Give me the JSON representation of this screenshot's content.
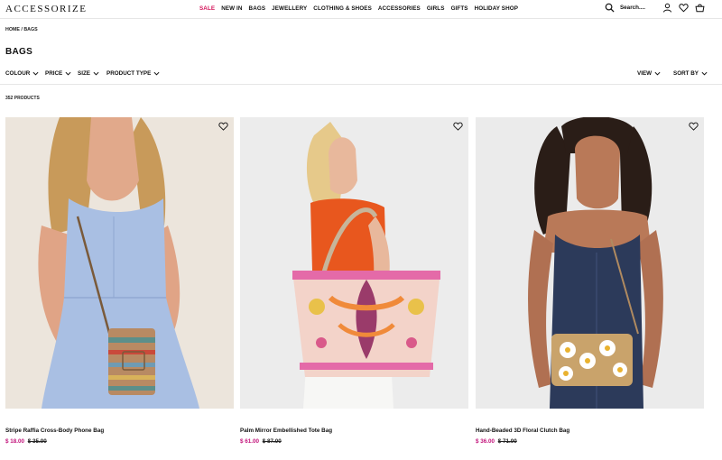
{
  "header": {
    "logo": "ACCESSORIZE",
    "nav": [
      {
        "label": "SALE",
        "name": "nav-item-sale"
      },
      {
        "label": "NEW IN",
        "name": "nav-item-new-in"
      },
      {
        "label": "BAGS",
        "name": "nav-item-bags"
      },
      {
        "label": "JEWELLERY",
        "name": "nav-item-jewellery"
      },
      {
        "label": "CLOTHING & SHOES",
        "name": "nav-item-clothing-shoes"
      },
      {
        "label": "ACCESSORIES",
        "name": "nav-item-accessories"
      },
      {
        "label": "GIRLS",
        "name": "nav-item-girls"
      },
      {
        "label": "GIFTS",
        "name": "nav-item-gifts"
      },
      {
        "label": "HOLIDAY SHOP",
        "name": "nav-item-holiday-shop"
      }
    ],
    "search_placeholder": "Search....",
    "icons": [
      "search-icon",
      "account-icon",
      "wishlist-icon",
      "basket-icon"
    ]
  },
  "breadcrumb": {
    "home": "HOME",
    "separator": "/",
    "current": "BAGS"
  },
  "page_title": "BAGS",
  "filters": {
    "colour": "COLOUR",
    "price": "PRICE",
    "size": "SIZE",
    "product_type": "PRODUCT TYPE",
    "view": "VIEW",
    "sort_by": "SORT BY"
  },
  "product_count": "352 PRODUCTS",
  "colors": {
    "sale": "#d4145a",
    "price": "#c2127a"
  },
  "products": [
    {
      "name": "Stripe Raffia Cross-Body Phone Bag",
      "price": "$ 18.00",
      "was": "$ 35.00"
    },
    {
      "name": "Palm Mirror Embellished Tote Bag",
      "price": "$ 61.00",
      "was": "$ 87.00"
    },
    {
      "name": "Hand-Beaded 3D Floral Clutch Bag",
      "price": "$ 36.00",
      "was": "$ 71.00"
    }
  ]
}
